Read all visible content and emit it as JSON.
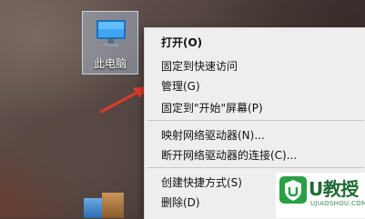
{
  "desktop": {
    "icon_label": "此电脑",
    "icon_name": "computer-monitor-icon"
  },
  "context_menu": {
    "items": [
      {
        "label": "打开(O)",
        "bold": true
      },
      {
        "label": "固定到快速访问"
      },
      {
        "label": "管理(G)"
      },
      {
        "label": "固定到\"开始\"屏幕(P)"
      },
      {
        "label": "映射网络驱动器(N)..."
      },
      {
        "label": "断开网络驱动器的连接(C)..."
      },
      {
        "label": "创建快捷方式(S)"
      },
      {
        "label": "删除(D)"
      }
    ]
  },
  "watermark": {
    "name": "U教授",
    "url": "UJIAOSHOU.COM",
    "color": "#27a046"
  },
  "arrow_color": "#e03a2a"
}
